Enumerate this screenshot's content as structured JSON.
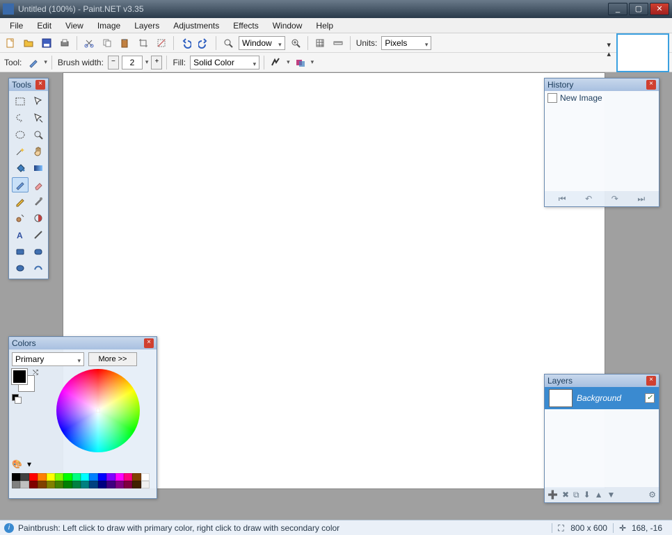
{
  "window": {
    "title": "Untitled (100%) - Paint.NET v3.35"
  },
  "menu": [
    "File",
    "Edit",
    "View",
    "Image",
    "Layers",
    "Adjustments",
    "Effects",
    "Window",
    "Help"
  ],
  "toolbar1": {
    "window_label": "Window",
    "units_label": "Units:",
    "units_value": "Pixels"
  },
  "toolbar2": {
    "tool_label": "Tool:",
    "brush_label": "Brush width:",
    "brush_value": "2",
    "fill_label": "Fill:",
    "fill_value": "Solid Color"
  },
  "panels": {
    "tools": {
      "title": "Tools"
    },
    "history": {
      "title": "History",
      "items": [
        "New Image"
      ]
    },
    "layers": {
      "title": "Layers",
      "rows": [
        {
          "name": "Background",
          "visible": true
        }
      ]
    },
    "colors": {
      "title": "Colors",
      "selector": "Primary",
      "more": "More >>",
      "palette": [
        "#000000",
        "#404040",
        "#ff0000",
        "#ff8000",
        "#ffff00",
        "#80ff00",
        "#00ff00",
        "#00ff80",
        "#00ffff",
        "#0080ff",
        "#0000ff",
        "#8000ff",
        "#ff00ff",
        "#ff0080",
        "#804000",
        "#ffffff",
        "#808080",
        "#c0c0c0",
        "#800000",
        "#804000",
        "#808000",
        "#408000",
        "#008000",
        "#008040",
        "#008080",
        "#004080",
        "#000080",
        "#400080",
        "#800080",
        "#800040",
        "#402000",
        "#f0f0f0"
      ]
    }
  },
  "status": {
    "hint": "Paintbrush: Left click to draw with primary color, right click to draw with secondary color",
    "dims": "800 x 600",
    "coords": "168, -16"
  }
}
